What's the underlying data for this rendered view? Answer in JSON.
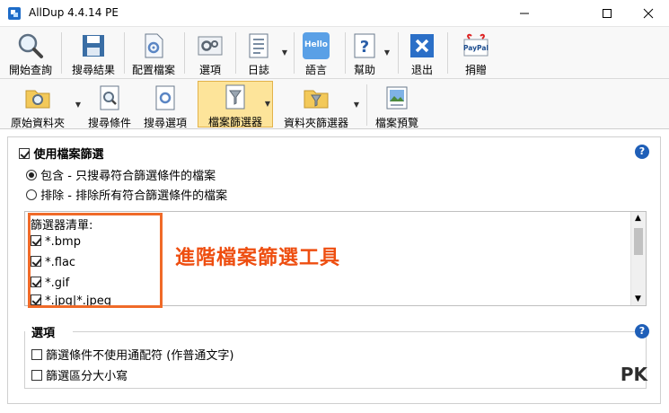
{
  "window": {
    "title": "AllDup 4.4.14 PE"
  },
  "toolbar_main": {
    "start_search": "開始查詢",
    "search_results": "搜尋結果",
    "config_files": "配置檔案",
    "options": "選項",
    "log": "日誌",
    "language": "語言",
    "help": "幫助",
    "exit": "退出",
    "donate": "捐贈",
    "language_icon_text": "Hello",
    "donate_icon_text": "PayPal"
  },
  "toolbar_sub": {
    "source_folder": "原始資料夾",
    "search_criteria": "搜尋條件",
    "search_items": "搜尋選項",
    "file_filter": "檔案篩選器",
    "folder_filter": "資料夾篩選器",
    "file_preview": "檔案預覽"
  },
  "filter": {
    "use_file_filter": "使用檔案篩選",
    "include": "包含 - 只搜尋符合篩選條件的檔案",
    "exclude": "排除 - 排除所有符合篩選條件的檔案",
    "list_title": "篩選器清單:",
    "items": [
      "*.bmp",
      "*.flac",
      "*.gif",
      "*.jpg|*.jpeg"
    ]
  },
  "options": {
    "title": "選項",
    "no_wildcard": "篩選條件不使用通配符 (作普通文字)",
    "case_sensitive": "篩選區分大小寫"
  },
  "annotation": "進階檔案篩選工具",
  "watermark": "PK",
  "help_symbol": "?",
  "colors": {
    "accent": "#1f5fb8",
    "annotation": "#ee4e10",
    "active_tab": "#fde49a"
  }
}
